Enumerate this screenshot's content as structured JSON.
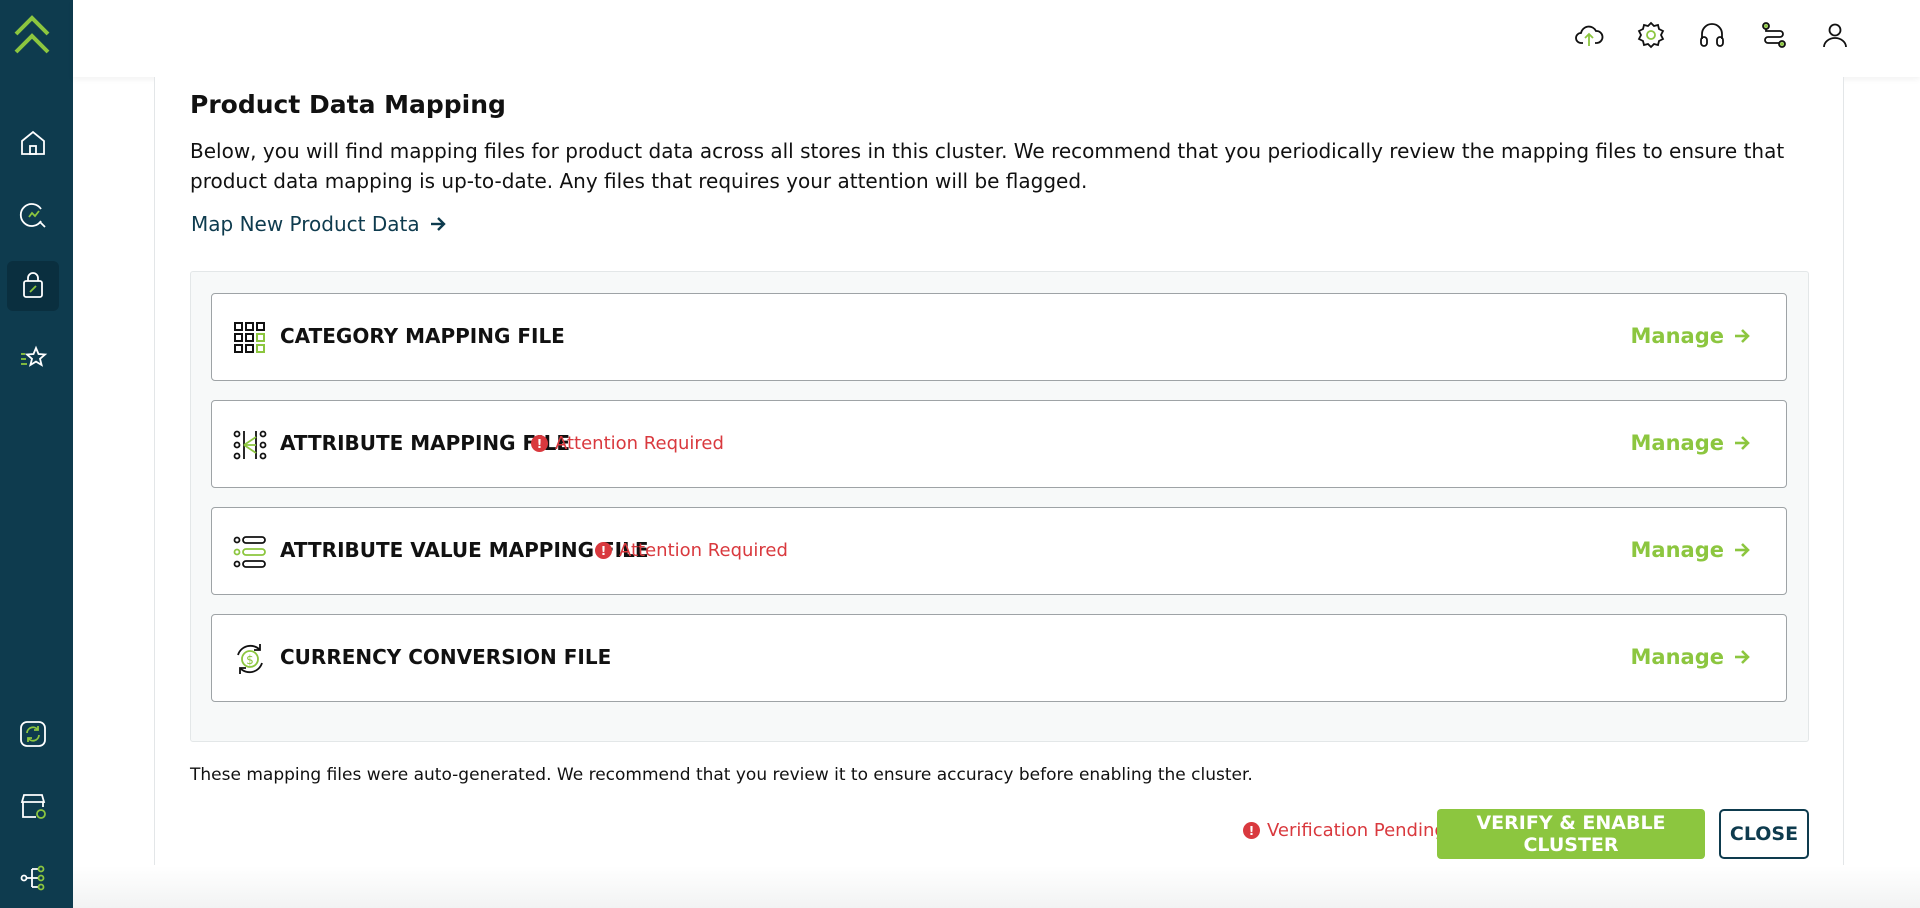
{
  "page": {
    "title": "Product Data Mapping",
    "description": "Below, you will find mapping files for product data across all stores in this cluster. We recommend that you periodically review the mapping files to ensure that product data mapping is up-to-date. Any files that requires your attention will be flagged.",
    "map_new_link": "Map New Product Data"
  },
  "files": [
    {
      "name": "CATEGORY MAPPING FILE",
      "icon": "grid-icon",
      "attention": "",
      "manage": "Manage"
    },
    {
      "name": "ATTRIBUTE MAPPING FILE",
      "icon": "attribute-map-icon",
      "attention": "Attention Required",
      "manage": "Manage"
    },
    {
      "name": "ATTRIBUTE VALUE MAPPING FILE",
      "icon": "list-icon",
      "attention": "Attention Required",
      "manage": "Manage"
    },
    {
      "name": "CURRENCY CONVERSION FILE",
      "icon": "currency-icon",
      "attention": "",
      "manage": "Manage"
    }
  ],
  "footer": {
    "note": "These mapping files were auto-generated. We recommend that you review it to ensure accuracy before enabling the cluster.",
    "status": "Verification Pending",
    "verify_label": "VERIFY & ENABLE CLUSTER",
    "close_label": "CLOSE"
  },
  "colors": {
    "sidebar": "#0e3b4e",
    "accent_green": "#8cc63f",
    "alert_red": "#d9393e",
    "link_navy": "#0e3b4e"
  },
  "sidebar_icons": [
    "home-icon",
    "search-analytics-icon",
    "product-bag-icon",
    "star-list-icon",
    "sync-icon",
    "store-icon",
    "hierarchy-icon"
  ],
  "top_icons": [
    "cloud-upload-icon",
    "settings-icon",
    "headset-icon",
    "workflow-icon",
    "user-icon"
  ]
}
